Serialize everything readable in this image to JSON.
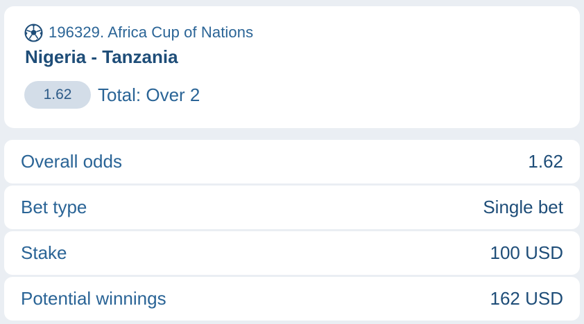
{
  "event": {
    "league": "196329. Africa Cup of Nations",
    "league_icon": "soccer-ball-icon",
    "match": "Nigeria - Tanzania",
    "odds": "1.62",
    "pick": "Total: Over 2"
  },
  "summary": [
    {
      "label": "Overall odds",
      "value": "1.62"
    },
    {
      "label": "Bet type",
      "value": "Single bet"
    },
    {
      "label": "Stake",
      "value": "100 USD"
    },
    {
      "label": "Potential winnings",
      "value": "162 USD"
    }
  ],
  "colors": {
    "background": "#eaeef3",
    "card": "#ffffff",
    "text_primary": "#2a6496",
    "text_dark": "#1e4d78",
    "pill": "#d3dde8"
  }
}
